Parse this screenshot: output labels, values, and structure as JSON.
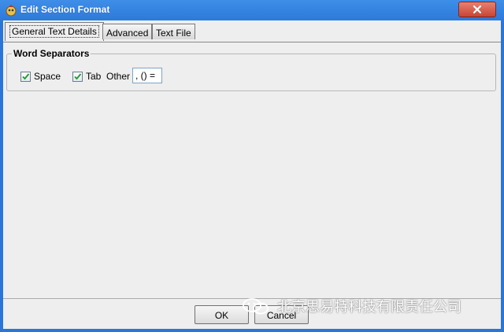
{
  "window": {
    "title": "Edit Section Format"
  },
  "tabs": [
    {
      "label": "General Text Details",
      "active": true
    },
    {
      "label": "Advanced",
      "active": false
    },
    {
      "label": "Text File",
      "active": false
    }
  ],
  "word_separators": {
    "title": "Word Separators",
    "space": {
      "label": "Space",
      "checked": true
    },
    "tab": {
      "label": "Tab",
      "checked": true
    },
    "other": {
      "label": "Other",
      "value": ", () ="
    }
  },
  "buttons": {
    "ok": "OK",
    "cancel": "Cancel"
  },
  "watermark": {
    "text": "北京思易特科技有限责任公司"
  },
  "colors": {
    "titlebar": "#2a76d8",
    "close": "#c94535",
    "dialog_bg": "#eeeeee"
  }
}
